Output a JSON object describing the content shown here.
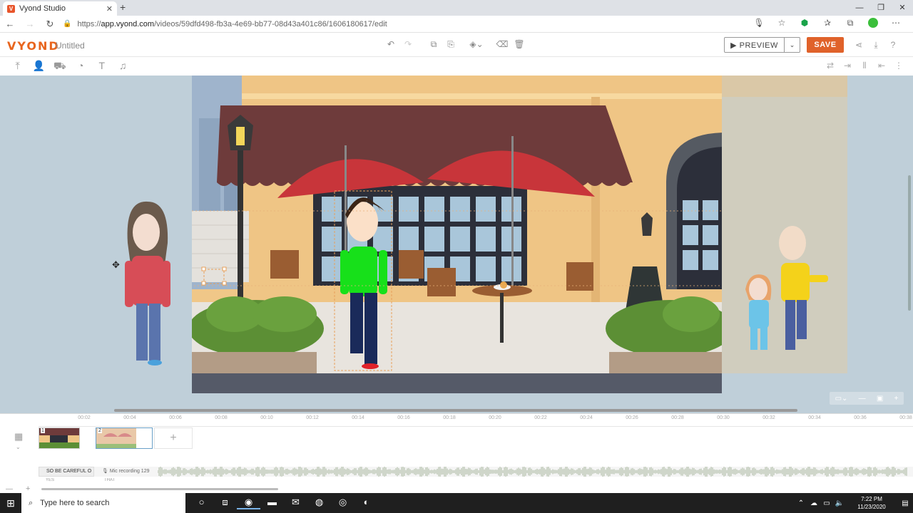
{
  "browser": {
    "tab_title": "Vyond Studio",
    "favicon": "V",
    "url_prefix": "https://",
    "url_host": "app.vyond.com",
    "url_path": "/videos/59dfd498-fb3a-4e69-bb77-08d43a401c86/1606180617/edit"
  },
  "header": {
    "logo": "VYOND",
    "doc_title": "Untitled",
    "preview_label": "PREVIEW",
    "save_label": "SAVE"
  },
  "timeline": {
    "ticks": [
      "00:02",
      "00:04",
      "00:06",
      "00:08",
      "00:10",
      "00:12",
      "00:14",
      "00:16",
      "00:18",
      "00:20",
      "00:22",
      "00:24",
      "00:26",
      "00:28",
      "00:30",
      "00:32",
      "00:34",
      "00:36",
      "00:38"
    ],
    "scene_numbers": [
      "1",
      "2"
    ],
    "audio_label": "SO BE CAREFUL O",
    "audio_label_2": "YES",
    "mic_label": "Mic recording 129",
    "mic_label_2": "THAT"
  },
  "taskbar": {
    "search_placeholder": "Type here to search",
    "time": "7:22 PM",
    "date": "11/23/2020"
  },
  "colors": {
    "accent": "#e0622a",
    "stage_bg": "#bfcfd9",
    "awning": "#6e3b3b",
    "umbrella": "#c8353a"
  }
}
